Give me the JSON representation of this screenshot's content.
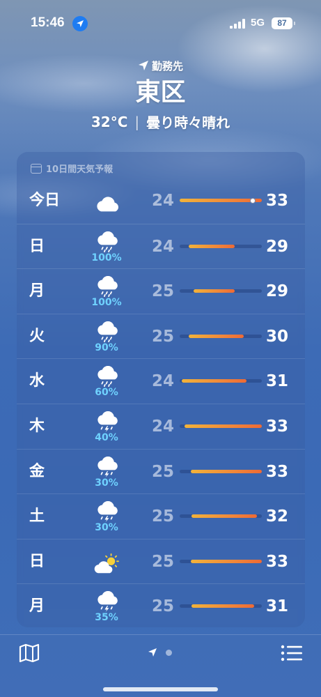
{
  "status_bar": {
    "time": "15:46",
    "network": "5G",
    "battery": "87"
  },
  "header": {
    "location_label": "勤務先",
    "city": "東区",
    "temperature": "32°C",
    "separator": "|",
    "condition": "曇り時々晴れ"
  },
  "forecast": {
    "title": "10日間天気予報",
    "range_min": 24,
    "range_max": 33,
    "current_temp": 32,
    "rows": [
      {
        "day": "今日",
        "icon": "cloud-icon",
        "precip": "",
        "low": "24",
        "high": "33",
        "bar_low": 24,
        "bar_high": 33
      },
      {
        "day": "日",
        "icon": "cloud-rain-icon",
        "precip": "100%",
        "low": "24",
        "high": "29",
        "bar_low": 25,
        "bar_high": 30
      },
      {
        "day": "月",
        "icon": "cloud-rain-icon",
        "precip": "100%",
        "low": "25",
        "high": "29",
        "bar_low": 25.5,
        "bar_high": 30
      },
      {
        "day": "火",
        "icon": "cloud-rain-icon",
        "precip": "90%",
        "low": "25",
        "high": "30",
        "bar_low": 25,
        "bar_high": 31
      },
      {
        "day": "水",
        "icon": "cloud-rain-icon",
        "precip": "60%",
        "low": "24",
        "high": "31",
        "bar_low": 24.2,
        "bar_high": 31.3
      },
      {
        "day": "木",
        "icon": "cloud-thunderstorm-icon",
        "precip": "40%",
        "low": "24",
        "high": "33",
        "bar_low": 24.5,
        "bar_high": 33
      },
      {
        "day": "金",
        "icon": "cloud-thunderstorm-icon",
        "precip": "30%",
        "low": "25",
        "high": "33",
        "bar_low": 25.2,
        "bar_high": 33
      },
      {
        "day": "土",
        "icon": "cloud-thunderstorm-icon",
        "precip": "30%",
        "low": "25",
        "high": "32",
        "bar_low": 25.3,
        "bar_high": 32.5
      },
      {
        "day": "日",
        "icon": "partly-sunny-icon",
        "precip": "",
        "low": "25",
        "high": "33",
        "bar_low": 25.2,
        "bar_high": 33
      },
      {
        "day": "月",
        "icon": "cloud-thunderstorm-icon",
        "precip": "35%",
        "low": "25",
        "high": "31",
        "bar_low": 25.3,
        "bar_high": 32.2
      }
    ]
  },
  "colors": {
    "precip": "#6fd2ff",
    "location_pill": "#1e7cf2",
    "bar_warm": "#f2b33a",
    "bar_hot": "#ee6a35"
  },
  "toolbar": {
    "left_icon": "map-icon",
    "right_icon": "list-icon",
    "pages": 2,
    "active_page": "current-location"
  }
}
